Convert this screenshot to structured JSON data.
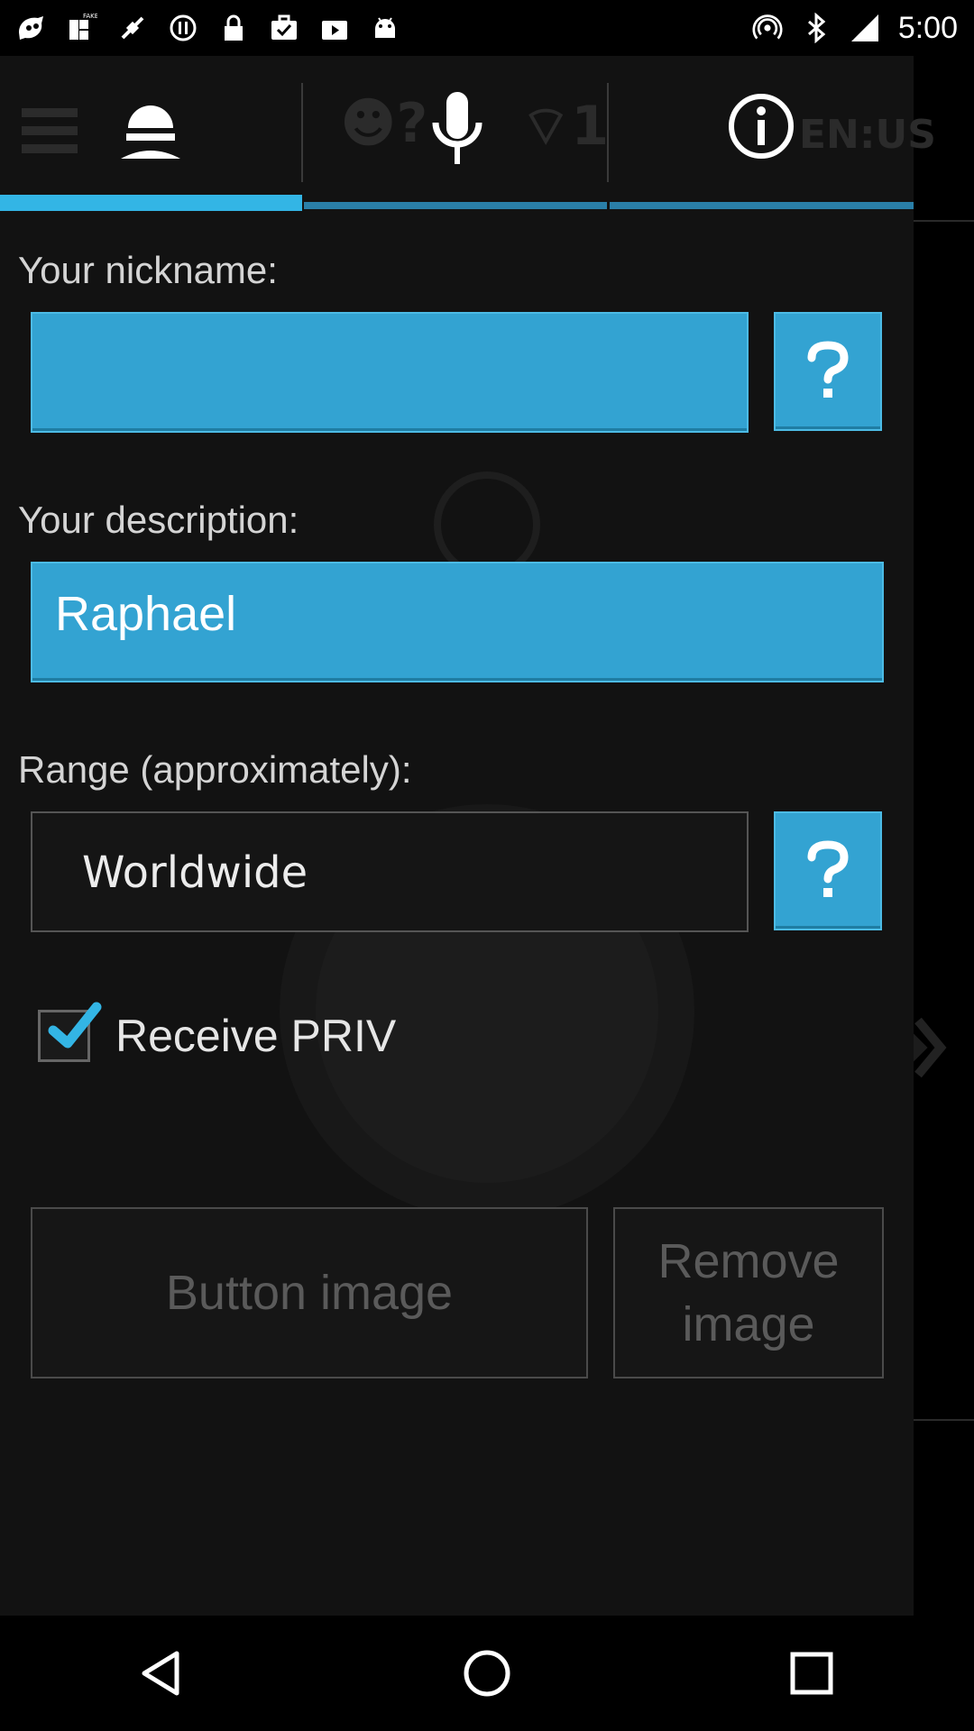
{
  "status_bar": {
    "time": "5:00",
    "left_icons": [
      "go-icon",
      "fake-gps-icon",
      "satellite-icon",
      "stop-icon",
      "lock-icon",
      "briefcase-check-icon",
      "play-store-icon",
      "android-icon"
    ],
    "right_icons": [
      "hotspot-icon",
      "bluetooth-icon",
      "signal-icon"
    ]
  },
  "tabs": [
    {
      "name": "profile",
      "icon": "person-icon",
      "active": true
    },
    {
      "name": "voice",
      "icon": "microphone-icon",
      "active": false
    },
    {
      "name": "info",
      "icon": "info-icon",
      "active": false
    }
  ],
  "form": {
    "nickname_label": "Your nickname:",
    "nickname_value": "",
    "description_label": "Your description:",
    "description_value": "Raphael",
    "range_label": "Range (approximately):",
    "range_value": "Worldwide",
    "help_label": "?",
    "receive_label": "Receive PRIV",
    "receive_checked": true
  },
  "buttons": {
    "button_image": "Button image",
    "remove_image_line1": "Remove",
    "remove_image_line2": "image"
  },
  "colors": {
    "accent": "#33b5e5",
    "field_blue": "#33a3d2"
  }
}
